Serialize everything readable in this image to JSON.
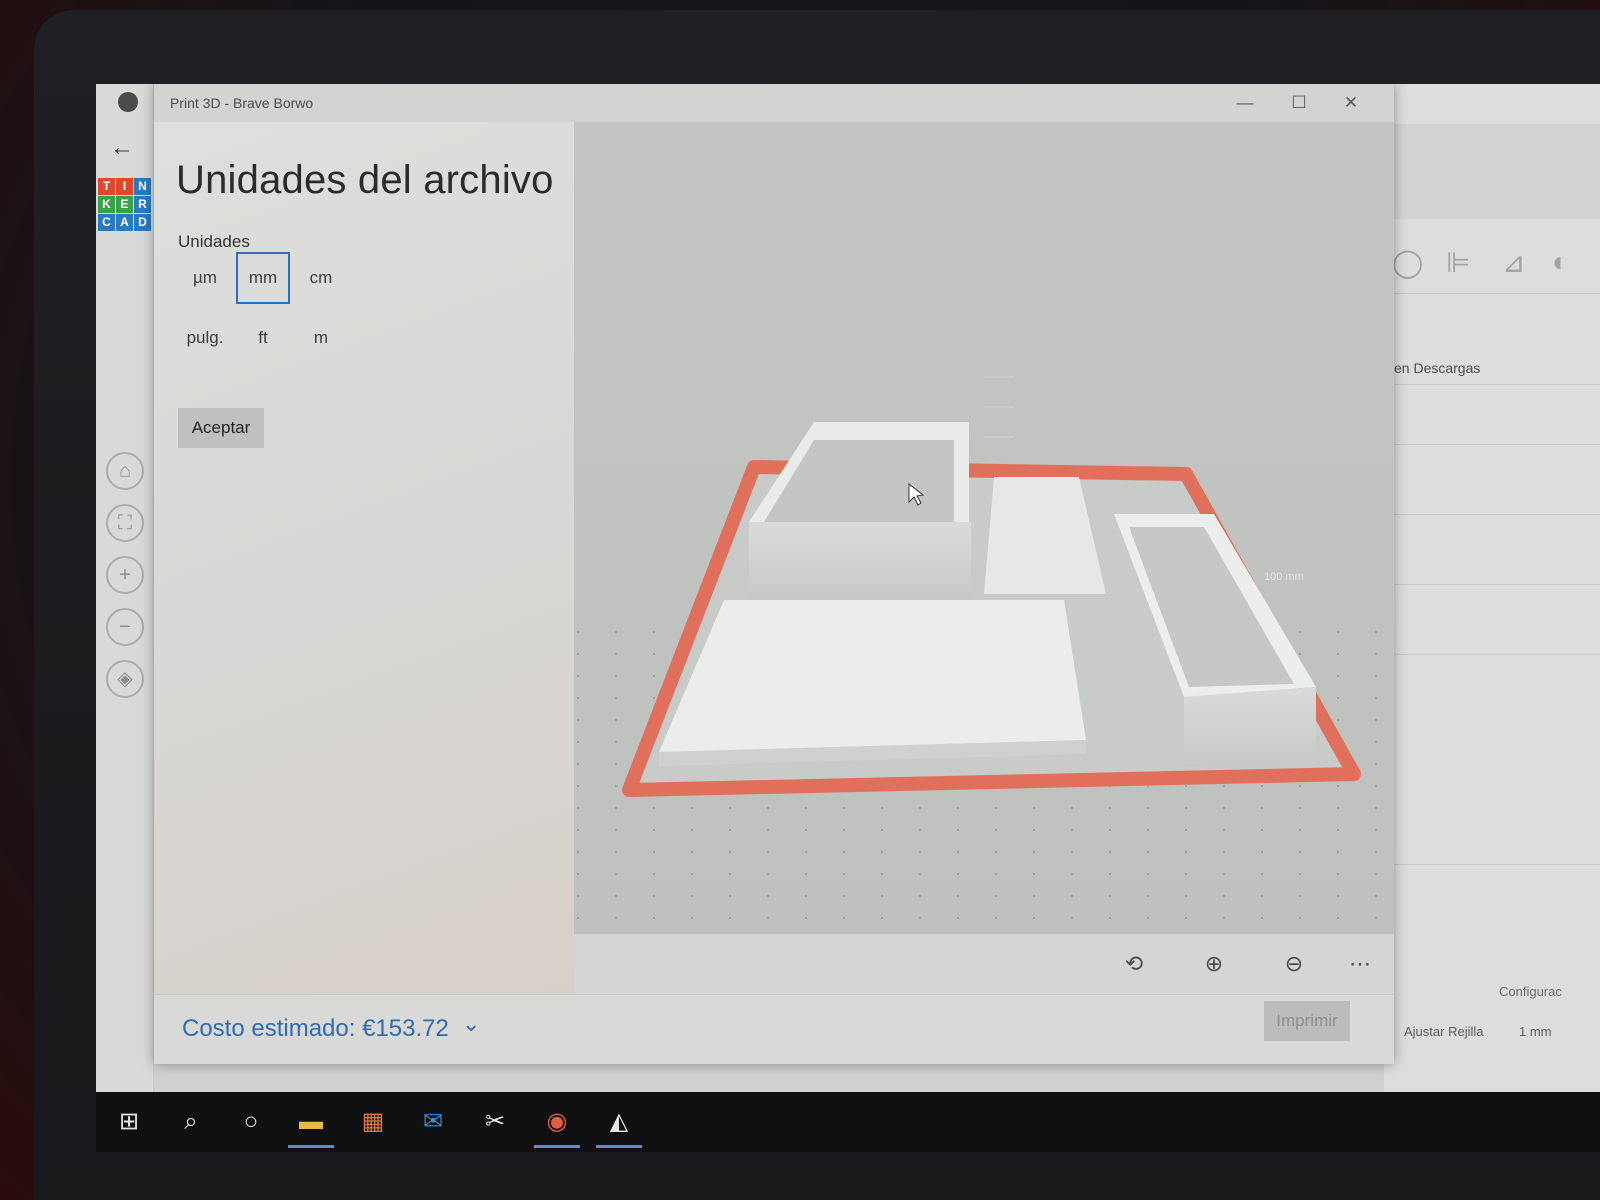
{
  "window": {
    "title": "Print 3D - Brave Borwo",
    "minimize": "—",
    "maximize": "☐",
    "close": "✕"
  },
  "panel": {
    "title": "Unidades del archivo",
    "units_label": "Unidades",
    "units": [
      "µm",
      "mm",
      "cm",
      "pulg.",
      "ft",
      "m"
    ],
    "selected_unit": "mm",
    "accept_label": "Aceptar"
  },
  "viewport": {
    "scale_label": "100 mm"
  },
  "view_toolbar": {
    "items": [
      {
        "icon": "rotate-view-icon",
        "glyph": "⟲"
      },
      {
        "icon": "zoom-in-icon",
        "glyph": "⊕"
      },
      {
        "icon": "zoom-out-icon",
        "glyph": "⊖"
      },
      {
        "icon": "more-icon",
        "glyph": "⋯"
      }
    ]
  },
  "footer": {
    "cost": "Costo estimado: €153.72",
    "cost_chevron": "⌄",
    "print_label": "Imprimir"
  },
  "background_app": {
    "logo_letters": [
      "T",
      "I",
      "N",
      "K",
      "E",
      "R",
      "C",
      "A",
      "D"
    ],
    "logo_colors": [
      "#e2462b",
      "#e2462b",
      "#2a7ac0",
      "#3aa14b",
      "#3aa14b",
      "#2a7ac0",
      "#2a7ac0",
      "#2a7ac0",
      "#2a7ac0"
    ],
    "downloads_text": "en Descargas",
    "config_text": "Configurac",
    "grid_label": "Ajustar Rejilla",
    "grid_value": "1 mm"
  },
  "taskbar": {
    "items": [
      {
        "icon": "windows-start-icon",
        "glyph": "⊞",
        "active": false
      },
      {
        "icon": "search-icon",
        "glyph": "⌕",
        "active": false
      },
      {
        "icon": "cortana-icon",
        "glyph": "○",
        "active": false
      },
      {
        "icon": "file-explorer-icon",
        "glyph": "▬",
        "active": true
      },
      {
        "icon": "store-icon",
        "glyph": "▦",
        "active": false
      },
      {
        "icon": "mail-icon",
        "glyph": "✉",
        "active": false
      },
      {
        "icon": "tools-icon",
        "glyph": "✂",
        "active": false
      },
      {
        "icon": "chrome-icon",
        "glyph": "◉",
        "active": true
      },
      {
        "icon": "print3d-icon",
        "glyph": "◭",
        "active": true
      }
    ]
  },
  "colors": {
    "accent": "#2f6fc2",
    "build_plate_border": "#e0705c"
  }
}
